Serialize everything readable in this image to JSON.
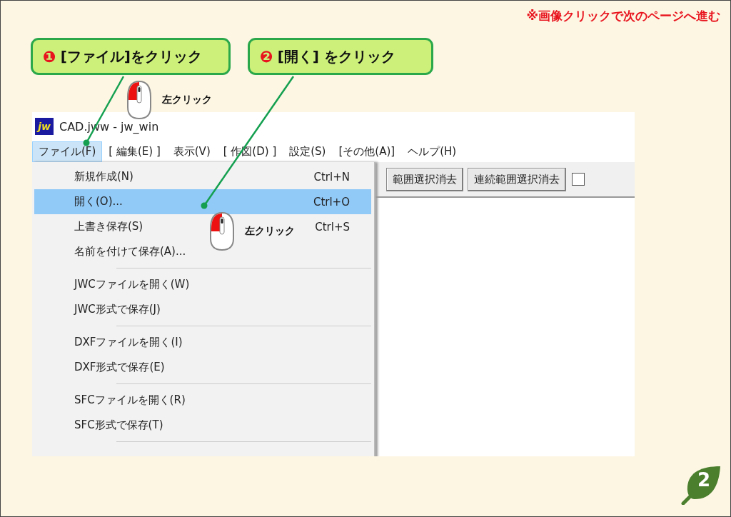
{
  "page_note": "※画像クリックで次のページへ進む",
  "callouts": [
    {
      "number": "❶",
      "text": "[ファイル]をクリック"
    },
    {
      "number": "❷",
      "text": "[開く] をクリック"
    }
  ],
  "click_labels": [
    "左クリック",
    "左クリック"
  ],
  "window": {
    "logo": "jw",
    "title": "CAD.jww - jw_win"
  },
  "menubar": [
    {
      "label": "ファイル(F)",
      "selected": true
    },
    {
      "label": "[ 編集(E) ]",
      "selected": false
    },
    {
      "label": "表示(V)",
      "selected": false
    },
    {
      "label": "[ 作図(D) ]",
      "selected": false
    },
    {
      "label": "設定(S)",
      "selected": false
    },
    {
      "label": "[その他(A)]",
      "selected": false
    },
    {
      "label": "ヘルプ(H)",
      "selected": false
    }
  ],
  "menu": {
    "items": [
      {
        "kind": "item",
        "label": "新規作成(N)",
        "shortcut": "Ctrl+N",
        "selected": false
      },
      {
        "kind": "item",
        "label": "開く(O)...",
        "shortcut": "Ctrl+O",
        "selected": true
      },
      {
        "kind": "item",
        "label": "上書き保存(S)",
        "shortcut": "Ctrl+S",
        "selected": false
      },
      {
        "kind": "item",
        "label": "名前を付けて保存(A)...",
        "selected": false
      },
      {
        "kind": "separator"
      },
      {
        "kind": "item",
        "label": "JWCファイルを開く(W)",
        "selected": false
      },
      {
        "kind": "item",
        "label": "JWC形式で保存(J)",
        "selected": false
      },
      {
        "kind": "separator"
      },
      {
        "kind": "item",
        "label": "DXFファイルを開く(I)",
        "selected": false
      },
      {
        "kind": "item",
        "label": "DXF形式で保存(E)",
        "selected": false
      },
      {
        "kind": "separator"
      },
      {
        "kind": "item",
        "label": "SFCファイルを開く(R)",
        "selected": false
      },
      {
        "kind": "item",
        "label": "SFC形式で保存(T)",
        "selected": false
      },
      {
        "kind": "separator"
      }
    ]
  },
  "toolbar": {
    "buttons": [
      "範囲選択消去",
      "連続範囲選択消去"
    ],
    "checkbox": {
      "checked": false
    }
  },
  "page_badge": "2"
}
